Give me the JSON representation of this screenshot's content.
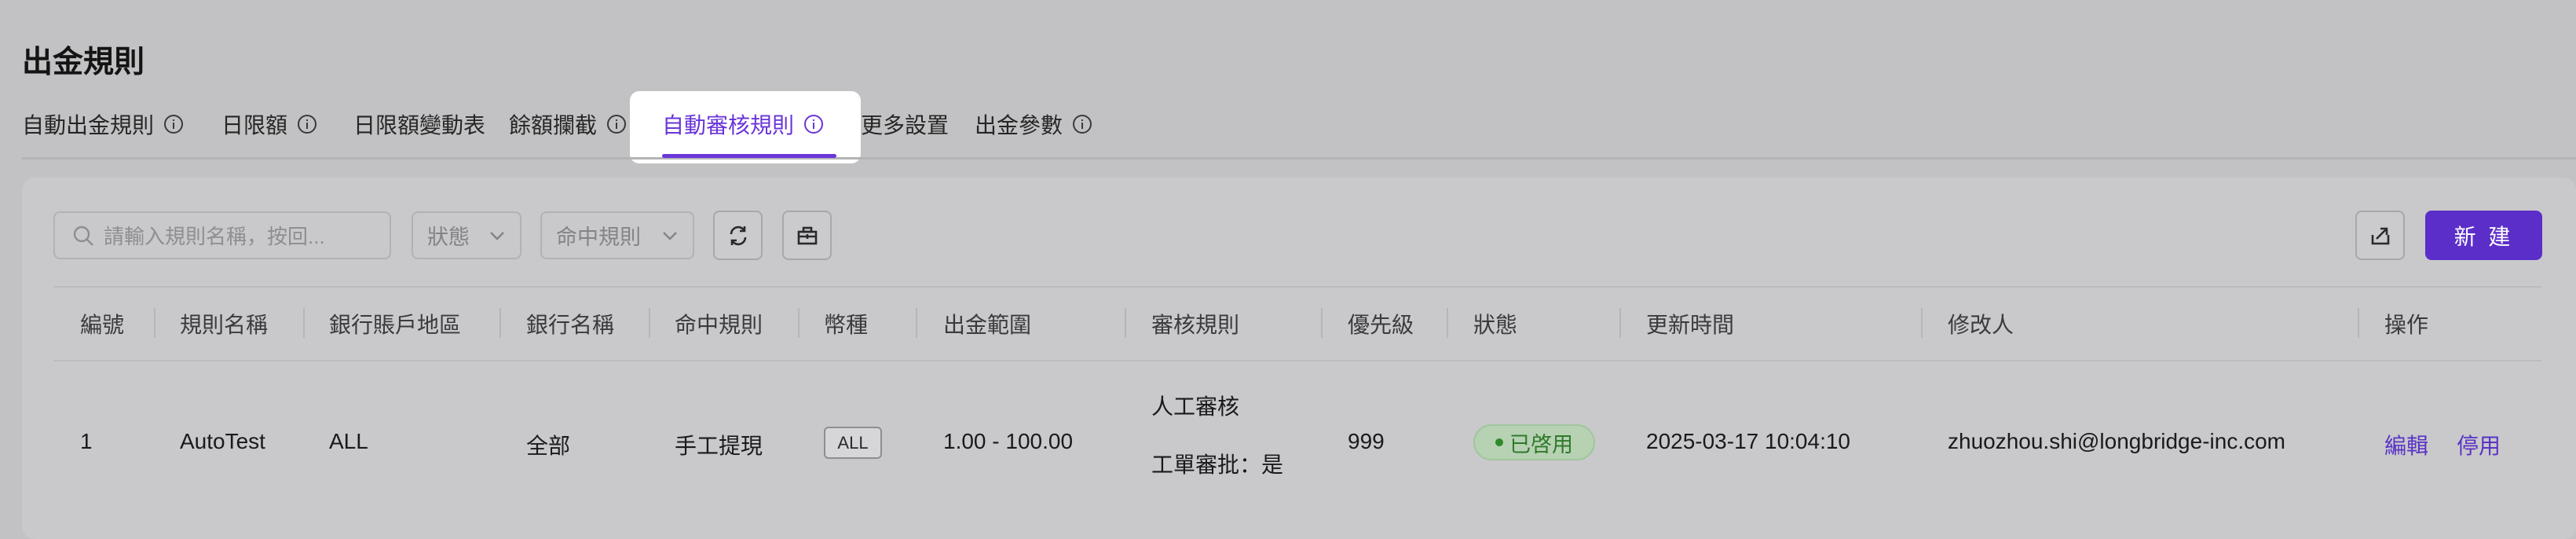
{
  "page": {
    "title": "出金規則"
  },
  "tabs": [
    {
      "label": "自動出金規則",
      "info": true
    },
    {
      "label": "日限額",
      "info": true
    },
    {
      "label": "日限額變動表",
      "info": false
    },
    {
      "label": "餘額攔截",
      "info": true
    },
    {
      "label": "自動審核規則",
      "info": true,
      "active": true
    },
    {
      "label": "更多設置",
      "info": false
    },
    {
      "label": "出金參數",
      "info": true
    }
  ],
  "toolbar": {
    "search_placeholder": "請輸入規則名稱，按回...",
    "status_dropdown": "狀態",
    "hit_rule_dropdown": "命中規則",
    "new_button": "新 建"
  },
  "table": {
    "columns": [
      "編號",
      "規則名稱",
      "銀行賬戶地區",
      "銀行名稱",
      "命中規則",
      "幣種",
      "出金範圍",
      "審核規則",
      "優先級",
      "狀態",
      "更新時間",
      "修改人",
      "操作"
    ],
    "rows": [
      {
        "id": "1",
        "name": "AutoTest",
        "region": "ALL",
        "bank": "全部",
        "hit_rule": "手工提現",
        "currency": "ALL",
        "range": "1.00 - 100.00",
        "review_rule_1": "人工審核",
        "review_rule_2": "工單審批：是",
        "priority": "999",
        "status": "已啓用",
        "updated": "2025-03-17 10:04:10",
        "modifier": "zhuozhou.shi@longbridge-inc.com",
        "actions": {
          "edit": "編輯",
          "disable": "停用"
        }
      }
    ]
  },
  "colors": {
    "accent": "#6a35d8",
    "primary_button": "#5b2ec9",
    "status_green": "#2e7a2a"
  }
}
